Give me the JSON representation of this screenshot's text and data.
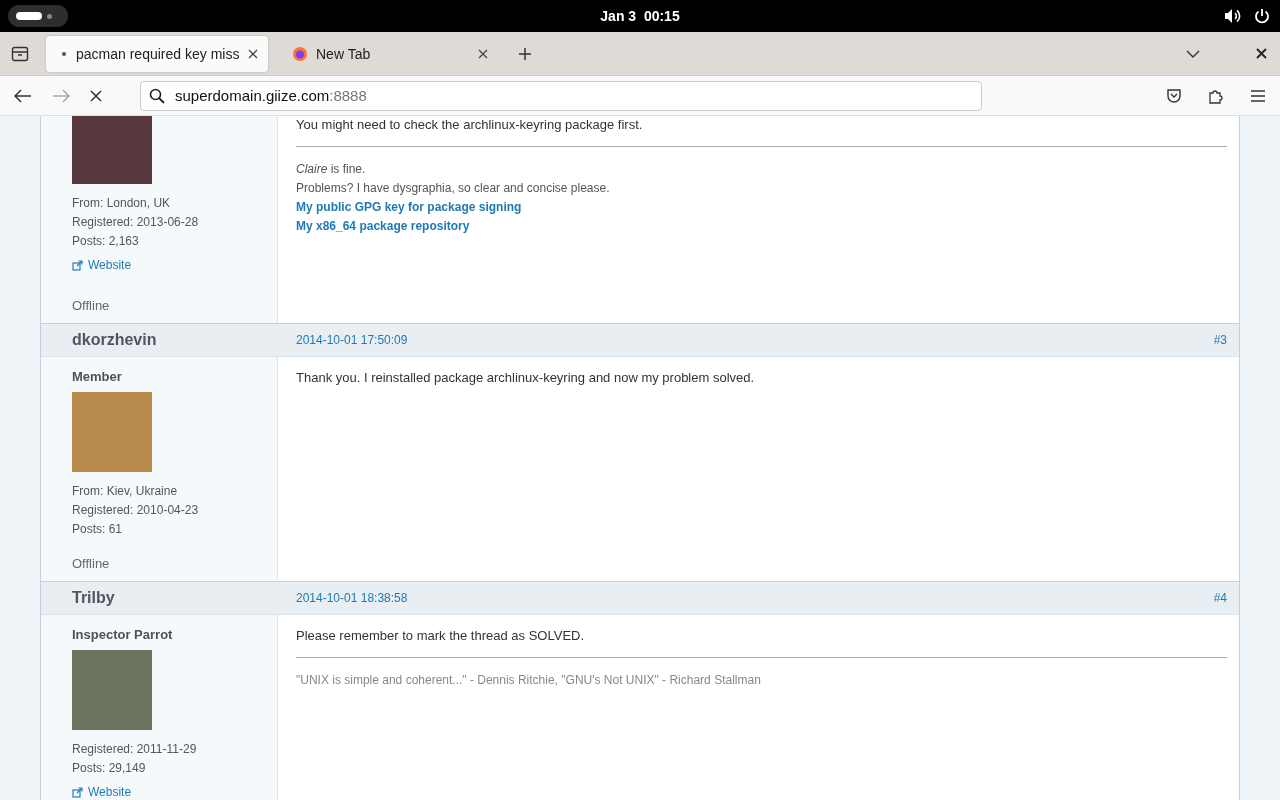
{
  "topbar": {
    "clock": "Jan 3  00:15"
  },
  "tabs": [
    {
      "title": "pacman required key miss",
      "selected": true,
      "loading": true
    },
    {
      "title": "New Tab",
      "selected": false,
      "loading": false
    }
  ],
  "address": {
    "host": "superdomain.giize.com",
    "port": ":8888"
  },
  "posts": [
    {
      "from": "From: London, UK",
      "registered": "Registered: 2013-06-28",
      "posts": "Posts: 2,163",
      "website": "Website",
      "status": "Offline",
      "message": "You might need to check the archlinux-keyring package first.",
      "signature": [
        {
          "kind": "text",
          "text": "*Claire* is fine."
        },
        {
          "kind": "text",
          "text": "Problems? I have dysgraphia, so clear and concise please."
        },
        {
          "kind": "link",
          "text": "My public GPG key for package signing"
        },
        {
          "kind": "link",
          "text": "My x86_64 package repository"
        }
      ]
    },
    {
      "header": {
        "author": "dkorzhevin",
        "date": "2014-10-01 17:50:09",
        "number": "#3"
      },
      "rank": "Member",
      "from": "From: Kiev, Ukraine",
      "registered": "Registered: 2010-04-23",
      "posts": "Posts: 61",
      "status": "Offline",
      "message": "Thank you. I reinstalled package archlinux-keyring and now my problem solved."
    },
    {
      "header": {
        "author": "Trilby",
        "date": "2014-10-01 18:38:58",
        "number": "#4"
      },
      "rank": "Inspector Parrot",
      "registered": "Registered: 2011-11-29",
      "posts": "Posts: 29,149",
      "website": "Website",
      "message": "Please remember to mark the thread as SOLVED.",
      "signature": [
        {
          "kind": "quote",
          "text": "\"UNIX is simple and coherent...\" - Dennis Ritchie, \"GNU's Not UNIX\" -  Richard Stallman"
        }
      ]
    }
  ]
}
